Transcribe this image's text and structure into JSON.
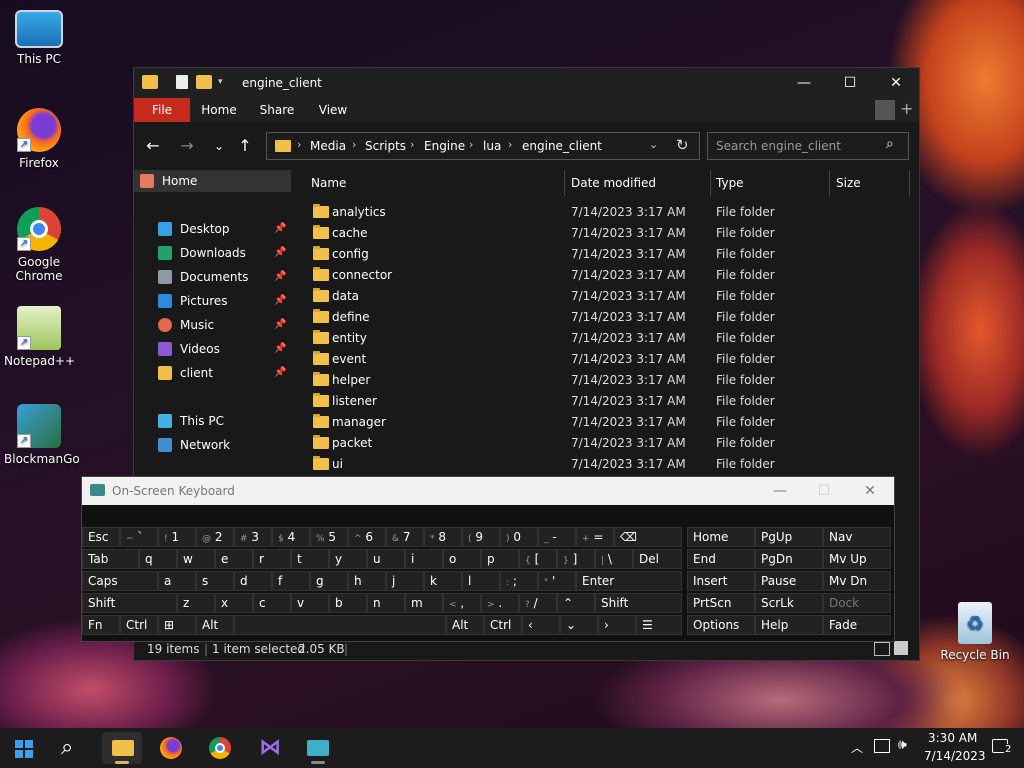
{
  "desktop": {
    "icons": [
      {
        "label": "This PC"
      },
      {
        "label": "Firefox"
      },
      {
        "label": "Google Chrome"
      },
      {
        "label": "Notepad++"
      },
      {
        "label": "BlockmanGo"
      },
      {
        "label": "Recycle Bin"
      }
    ]
  },
  "explorer": {
    "title": "engine_client",
    "ribbon": {
      "file": "File",
      "home": "Home",
      "share": "Share",
      "view": "View"
    },
    "breadcrumb": [
      "Media",
      "Scripts",
      "Engine",
      "lua",
      "engine_client"
    ],
    "search_placeholder": "Search engine_client",
    "nav": {
      "home": "Home",
      "desktop": "Desktop",
      "downloads": "Downloads",
      "documents": "Documents",
      "pictures": "Pictures",
      "music": "Music",
      "videos": "Videos",
      "client": "client",
      "this_pc": "This PC",
      "network": "Network"
    },
    "columns": {
      "name": "Name",
      "date": "Date modified",
      "type": "Type",
      "size": "Size"
    },
    "files": [
      {
        "name": "analytics",
        "date": "7/14/2023 3:17 AM",
        "type": "File folder"
      },
      {
        "name": "cache",
        "date": "7/14/2023 3:17 AM",
        "type": "File folder"
      },
      {
        "name": "config",
        "date": "7/14/2023 3:17 AM",
        "type": "File folder"
      },
      {
        "name": "connector",
        "date": "7/14/2023 3:17 AM",
        "type": "File folder"
      },
      {
        "name": "data",
        "date": "7/14/2023 3:17 AM",
        "type": "File folder"
      },
      {
        "name": "define",
        "date": "7/14/2023 3:17 AM",
        "type": "File folder"
      },
      {
        "name": "entity",
        "date": "7/14/2023 3:17 AM",
        "type": "File folder"
      },
      {
        "name": "event",
        "date": "7/14/2023 3:17 AM",
        "type": "File folder"
      },
      {
        "name": "helper",
        "date": "7/14/2023 3:17 AM",
        "type": "File folder"
      },
      {
        "name": "listener",
        "date": "7/14/2023 3:17 AM",
        "type": "File folder"
      },
      {
        "name": "manager",
        "date": "7/14/2023 3:17 AM",
        "type": "File folder"
      },
      {
        "name": "packet",
        "date": "7/14/2023 3:17 AM",
        "type": "File folder"
      },
      {
        "name": "ui",
        "date": "7/14/2023 3:17 AM",
        "type": "File folder"
      }
    ],
    "status": {
      "items": "19 items",
      "selected": "1 item selected",
      "size": "2.05 KB"
    }
  },
  "osk": {
    "title": "On-Screen Keyboard",
    "keys": {
      "esc": "Esc",
      "tab": "Tab",
      "caps": "Caps",
      "shift": "Shift",
      "fn": "Fn",
      "ctrl": "Ctrl",
      "alt": "Alt",
      "del": "Del",
      "enter": "Enter",
      "rshift": "Shift",
      "ralt": "Alt",
      "rctrl": "Ctrl",
      "home": "Home",
      "pgup": "PgUp",
      "nav": "Nav",
      "end": "End",
      "pgdn": "PgDn",
      "mvup": "Mv Up",
      "insert": "Insert",
      "pause": "Pause",
      "mvdn": "Mv Dn",
      "prtscn": "PrtScn",
      "scrlk": "ScrLk",
      "dock": "Dock",
      "options": "Options",
      "help": "Help",
      "fade": "Fade"
    },
    "row1": [
      {
        "s": "~",
        "m": "`"
      },
      {
        "s": "!",
        "m": "1"
      },
      {
        "s": "@",
        "m": "2"
      },
      {
        "s": "#",
        "m": "3"
      },
      {
        "s": "$",
        "m": "4"
      },
      {
        "s": "%",
        "m": "5"
      },
      {
        "s": "^",
        "m": "6"
      },
      {
        "s": "&",
        "m": "7"
      },
      {
        "s": "*",
        "m": "8"
      },
      {
        "s": "(",
        "m": "9"
      },
      {
        "s": ")",
        "m": "0"
      },
      {
        "s": "_",
        "m": "-"
      },
      {
        "s": "+",
        "m": "="
      }
    ],
    "row2": [
      "q",
      "w",
      "e",
      "r",
      "t",
      "y",
      "u",
      "i",
      "o",
      "p"
    ],
    "row2_sym": [
      {
        "s": "{",
        "m": "["
      },
      {
        "s": "}",
        "m": "]"
      },
      {
        "s": "|",
        "m": "\\"
      }
    ],
    "row3": [
      "a",
      "s",
      "d",
      "f",
      "g",
      "h",
      "j",
      "k",
      "l"
    ],
    "row3_sym": [
      {
        "s": ":",
        "m": ";"
      },
      {
        "s": "\"",
        "m": "'"
      }
    ],
    "row4": [
      "z",
      "x",
      "c",
      "v",
      "b",
      "n",
      "m"
    ],
    "row4_sym": [
      {
        "s": "<",
        "m": ","
      },
      {
        "s": ">",
        "m": "."
      },
      {
        "s": "?",
        "m": "/"
      }
    ]
  },
  "taskbar": {
    "time": "3:30 AM",
    "date": "7/14/2023",
    "notif_count": "2"
  },
  "colors": {
    "accent_file_tab": "#c42b1c",
    "folder": "#f1c04a",
    "taskbar_bg": "#1c1c1c"
  }
}
